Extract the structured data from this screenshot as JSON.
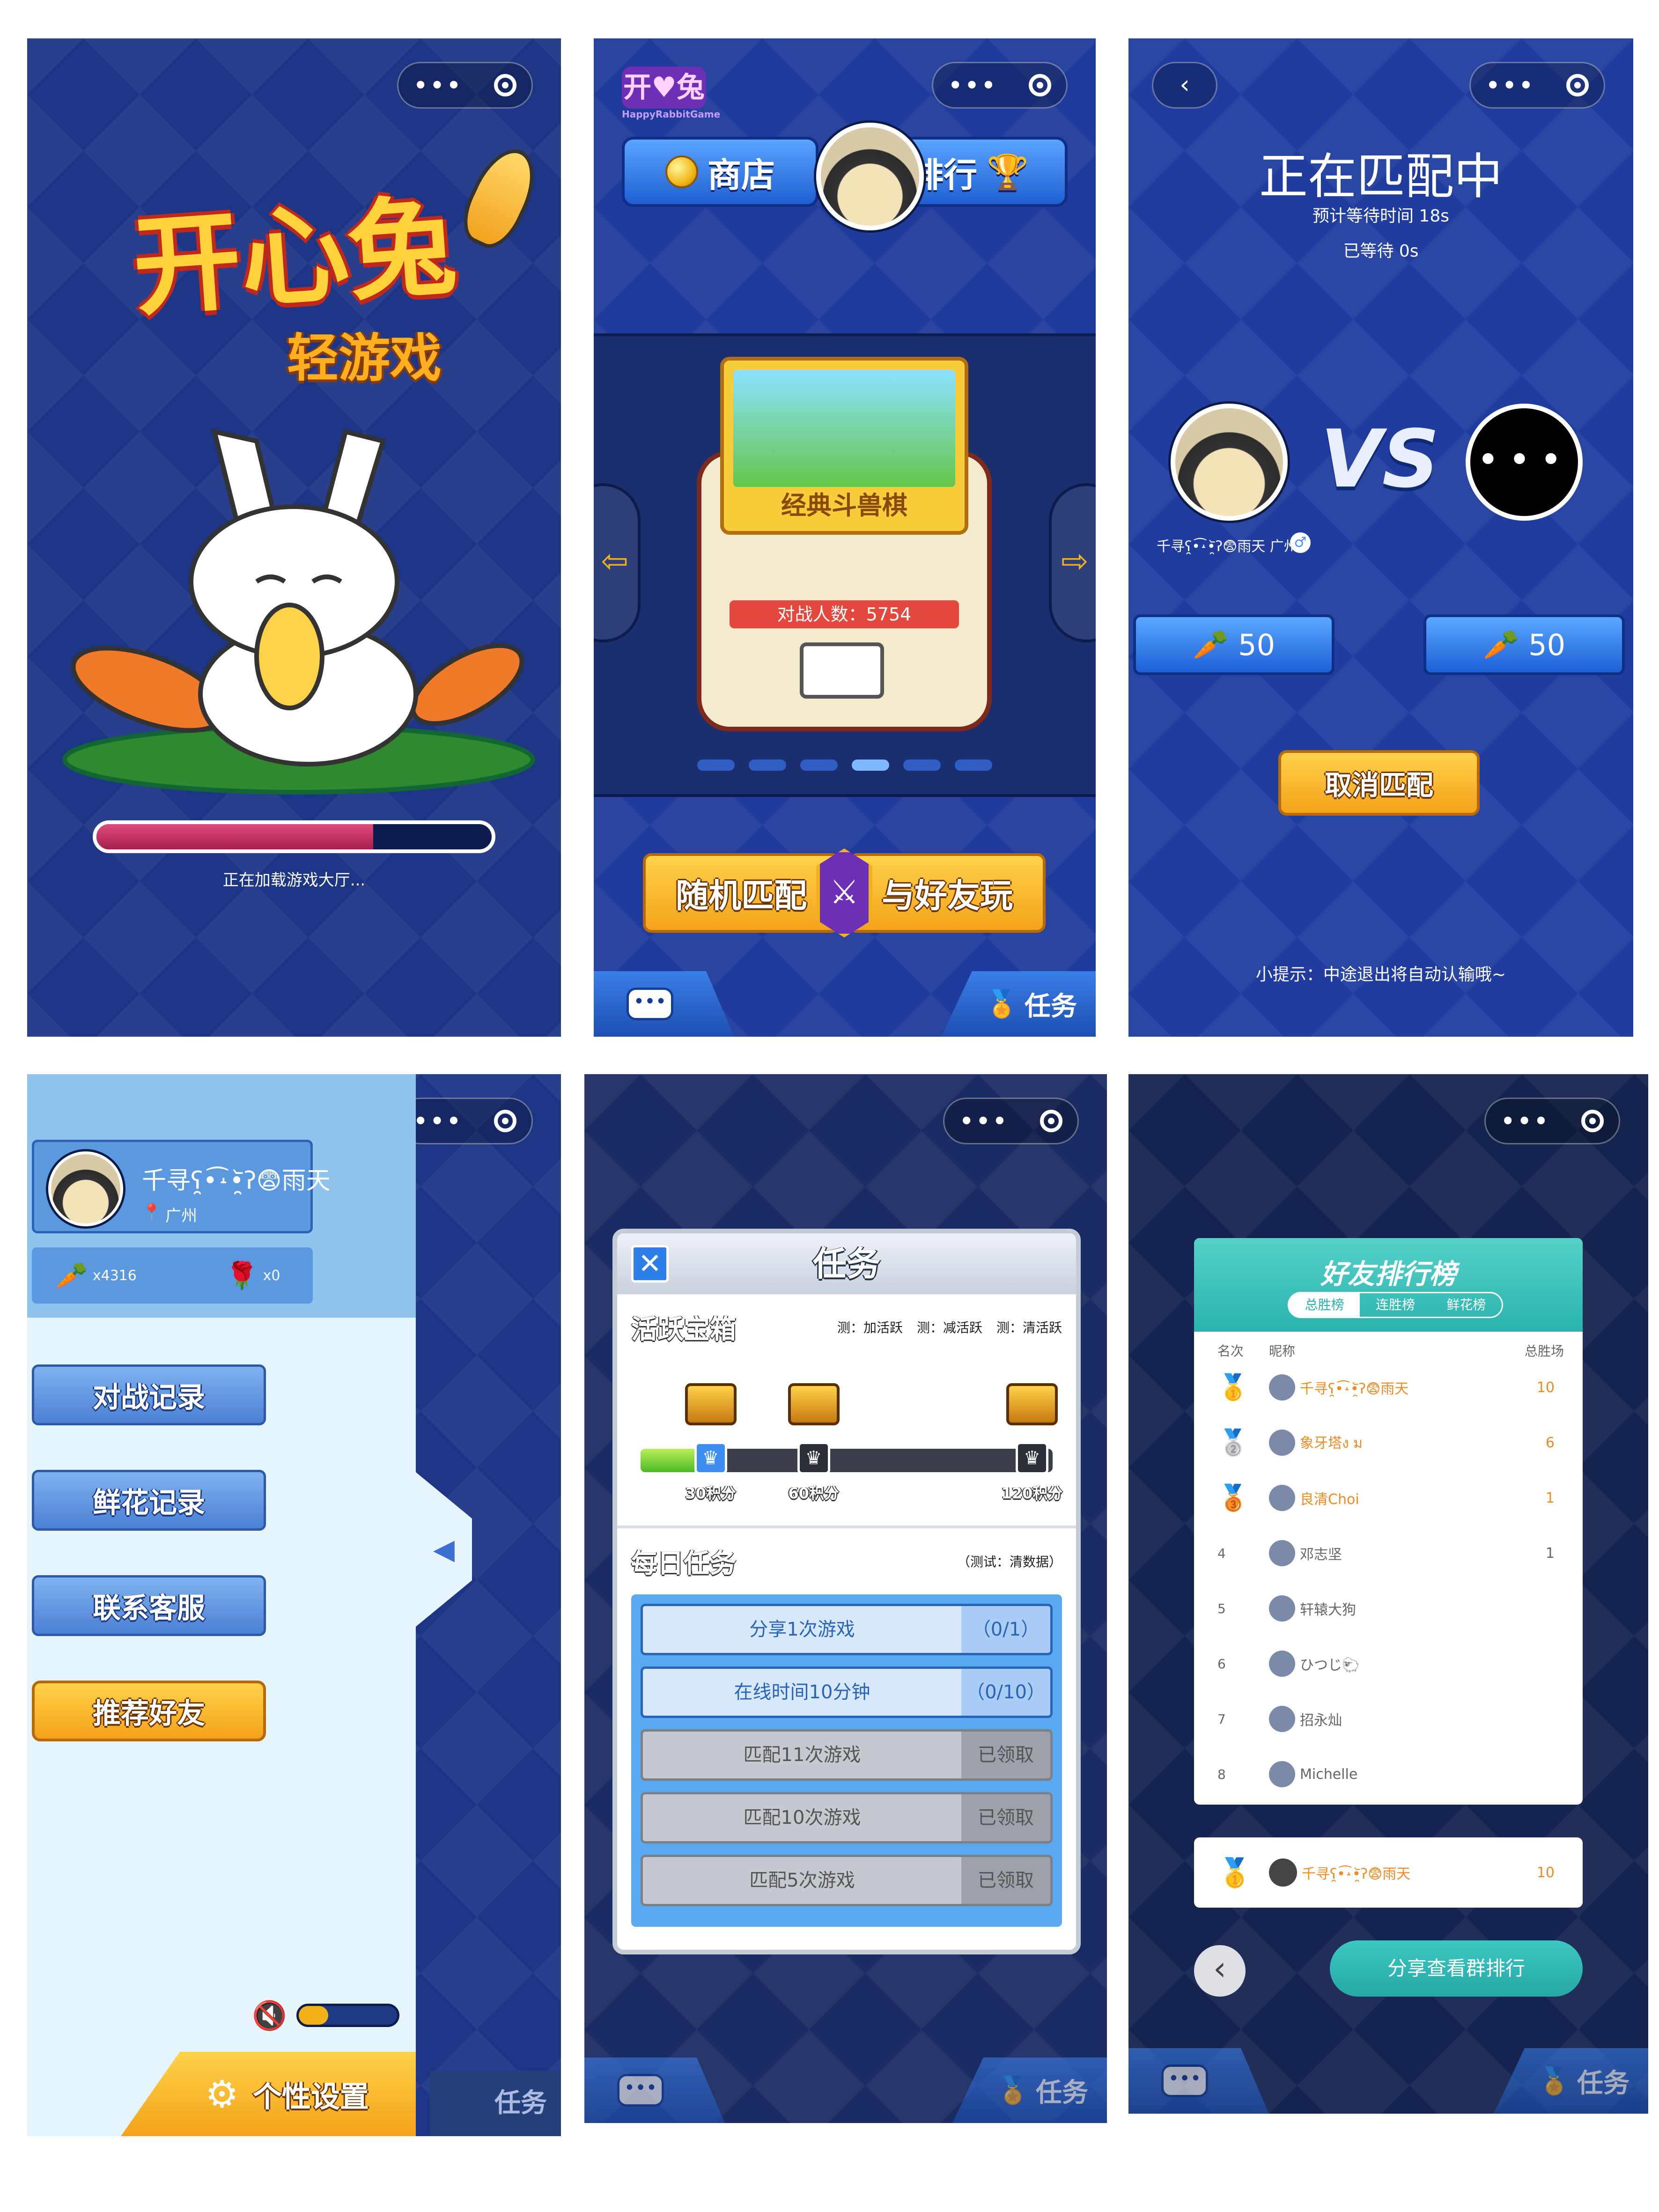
{
  "loading": {
    "logo_main": "开心兔",
    "logo_sub": "轻游戏",
    "progress": 0.7,
    "status_text": "正在加载游戏大厅..."
  },
  "lobby": {
    "brand": "HappyRabbitGame",
    "shop_label": "商店",
    "rank_label": "排行",
    "game_name": "经典斗兽棋",
    "players_label": "对战人数：",
    "players_count": "5754",
    "carousel_dots": 6,
    "carousel_active": 3,
    "random_match_label": "随机匹配",
    "friend_play_label": "与好友玩",
    "task_label": "任务"
  },
  "matching": {
    "title": "正在匹配中",
    "estimate_text": "预计等待时间 18s",
    "waited_text": "已等待 0s",
    "vs_text": "VS",
    "player_name": "千寻ʕ̯•͡˔•̯᷅ʔ😨雨天 广州",
    "left_score": "50",
    "right_score": "50",
    "cancel_label": "取消匹配",
    "tip_text": "小提示：中途退出将自动认输哦~"
  },
  "sidebar": {
    "user_name": "千寻ʕ̯•͡˔•̯᷅ʔ😨雨天",
    "city": "广州",
    "carrots": "x4316",
    "flowers": "x0",
    "menu": [
      {
        "label": "对战记录",
        "style": "blue"
      },
      {
        "label": "鲜花记录",
        "style": "blue"
      },
      {
        "label": "联系客服",
        "style": "blue"
      },
      {
        "label": "推荐好友",
        "style": "yellow"
      }
    ],
    "settings_label": "个性设置",
    "volume": 0.3
  },
  "tasks": {
    "title": "任务",
    "active_title": "活跃宝箱",
    "active_tests": [
      "测：加活跃",
      "测：减活跃",
      "测：清活跃"
    ],
    "active_progress": 0.18,
    "milestones": [
      "30积分",
      "60积分",
      "120积分"
    ],
    "daily_title": "每日任务",
    "daily_test": "（测试：清数据）",
    "items": [
      {
        "name": "分享1次游戏",
        "status": "（0/1）",
        "state": "active"
      },
      {
        "name": "在线时间10分钟",
        "status": "（0/10）",
        "state": "active"
      },
      {
        "name": "匹配11次游戏",
        "status": "已领取",
        "state": "done"
      },
      {
        "name": "匹配10次游戏",
        "status": "已领取",
        "state": "done"
      },
      {
        "name": "匹配5次游戏",
        "status": "已领取",
        "state": "done"
      }
    ]
  },
  "ranking": {
    "title": "好友排行榜",
    "tabs": [
      "总胜榜",
      "连胜榜",
      "鲜花榜"
    ],
    "active_tab": 0,
    "headers": [
      "名次",
      "昵称",
      "总胜场"
    ],
    "rows": [
      {
        "rank": "1",
        "name": "千寻ʕ̯•͡˔•̯᷅ʔ😨雨天",
        "wins": "10",
        "highlight": true
      },
      {
        "rank": "2",
        "name": "象牙塔ง  ม",
        "wins": "6",
        "highlight": true
      },
      {
        "rank": "3",
        "name": "良清Choi",
        "wins": "1",
        "highlight": true
      },
      {
        "rank": "4",
        "name": "邓志坚",
        "wins": "1",
        "highlight": false
      },
      {
        "rank": "5",
        "name": "轩辕大狗",
        "wins": "",
        "highlight": false
      },
      {
        "rank": "6",
        "name": "ひつじ🐑",
        "wins": "",
        "highlight": false
      },
      {
        "rank": "7",
        "name": "招永灿",
        "wins": "",
        "highlight": false
      },
      {
        "rank": "8",
        "name": "Michelle",
        "wins": "",
        "highlight": false
      }
    ],
    "self_row": {
      "rank": "1",
      "name": "千寻ʕ̯•͡˔•̯᷅ʔ😨雨天",
      "wins": "10"
    },
    "share_label": "分享查看群排行"
  },
  "colors": {
    "bg_blue": "#1a2f7a",
    "yellow": "#f3a31b",
    "teal": "#2ab8b0",
    "rank_orange": "#f08a24"
  }
}
